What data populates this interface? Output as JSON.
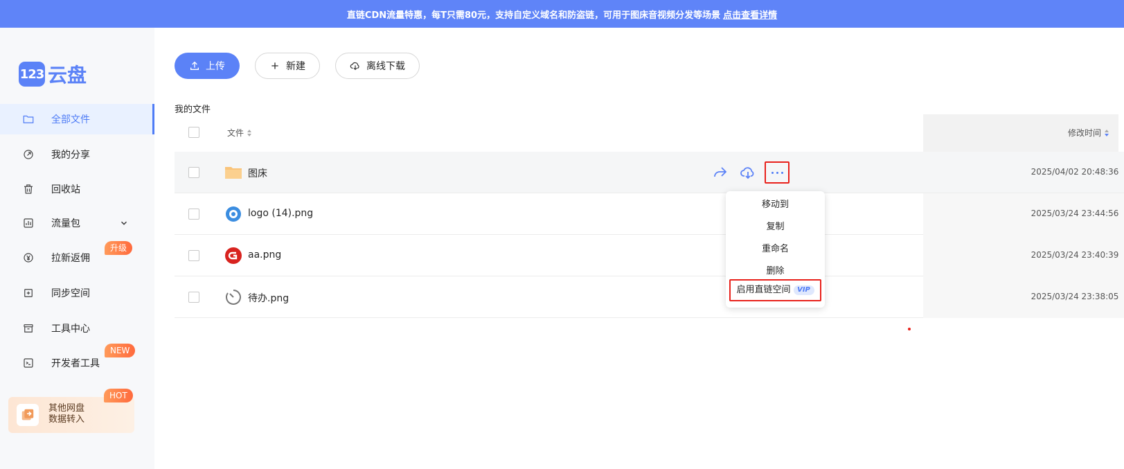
{
  "banner": {
    "text": "直链CDN流量特惠，每T只需80元，支持自定义域名和防盗链，可用于图床音视频分发等场景",
    "link": "点击查看详情"
  },
  "sidebar": {
    "logo_mark": "123",
    "logo_text": "云盘",
    "items": [
      {
        "label": "全部文件",
        "icon": "folder-icon",
        "active": true
      },
      {
        "label": "我的分享",
        "icon": "share-icon"
      },
      {
        "label": "回收站",
        "icon": "trash-icon"
      },
      {
        "label": "流量包",
        "icon": "chart-icon"
      },
      {
        "label": "拉新返佣",
        "icon": "yen-icon",
        "badge": "升级"
      },
      {
        "label": "同步空间",
        "icon": "sync-icon"
      },
      {
        "label": "工具中心",
        "icon": "toolbox-icon"
      },
      {
        "label": "开发者工具",
        "icon": "terminal-icon",
        "badge": "NEW"
      }
    ],
    "promo": {
      "line1": "其他网盘",
      "line2": "数据转入",
      "badge": "HOT"
    }
  },
  "toolbar": {
    "upload": "上传",
    "new": "新建",
    "offline": "离线下载"
  },
  "main": {
    "section_title": "我的文件",
    "columns": {
      "file": "文件",
      "time": "修改时间"
    },
    "rows": [
      {
        "name": "图床",
        "time": "2025/04/02 20:48:36",
        "icon": "folder-icon"
      },
      {
        "name": "logo (14).png",
        "time": "2025/03/24 23:44:56",
        "icon": "gear-logo-icon"
      },
      {
        "name": "aa.png",
        "time": "2025/03/24 23:40:39",
        "icon": "g-logo-icon"
      },
      {
        "name": "待办.png",
        "time": "2025/03/24 23:38:05",
        "icon": "timer-icon"
      }
    ]
  },
  "context_menu": {
    "items": [
      "移动到",
      "复制",
      "重命名",
      "删除"
    ],
    "direct_link": "启用直链空间",
    "vip": "VIP"
  },
  "colors": {
    "accent": "#5b82f7",
    "highlight_border": "#e8211b",
    "banner": "#5f84f8"
  }
}
